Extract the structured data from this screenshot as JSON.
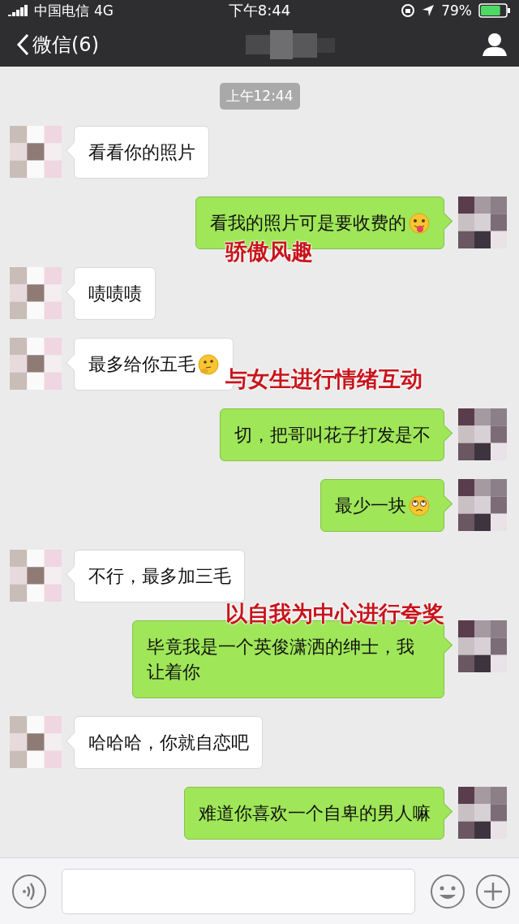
{
  "status_bar": {
    "carrier": "中国电信",
    "network": "4G",
    "time": "下午8:44",
    "battery": "79%"
  },
  "nav": {
    "back_label": "微信(6)"
  },
  "timestamp": "上午12:44",
  "messages": [
    {
      "kind": "incoming",
      "text": "看看你的照片"
    },
    {
      "kind": "outgoing",
      "text": "看我的照片可是要收费的",
      "emoji": {
        "kind": "tongue"
      },
      "annotation": {
        "kind": "below",
        "text": "骄傲风趣"
      }
    },
    {
      "kind": "incoming",
      "text": "啧啧啧"
    },
    {
      "kind": "incoming",
      "text": "最多给你五毛",
      "emoji": {
        "kind": "thinking"
      },
      "annotation": {
        "kind": "beside",
        "text": "与女生进行情绪互动"
      }
    },
    {
      "kind": "outgoing",
      "text": "切，把哥叫花子打发是不"
    },
    {
      "kind": "outgoing",
      "text": "最少一块",
      "emoji": {
        "kind": "rolling-eyes"
      }
    },
    {
      "kind": "incoming",
      "text": "不行，最多加三毛"
    },
    {
      "kind": "outgoing",
      "text": "毕竟我是一个英俊潇洒的绅士，我让着你",
      "annotation": {
        "kind": "above",
        "text": "以自我为中心进行夸奖"
      }
    },
    {
      "kind": "incoming",
      "text": "哈哈哈，你就自恋吧"
    },
    {
      "kind": "outgoing",
      "text": "难道你喜欢一个自卑的男人嘛"
    }
  ]
}
